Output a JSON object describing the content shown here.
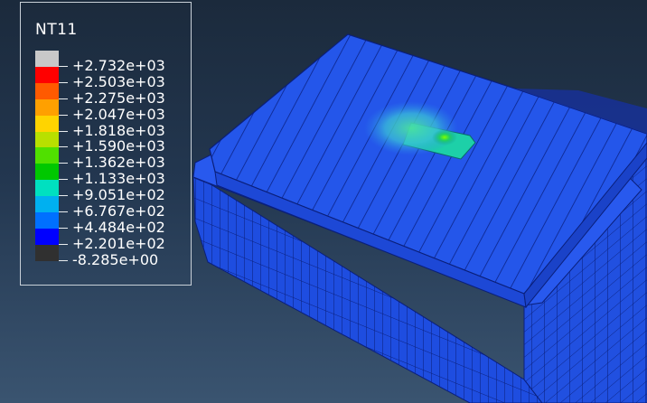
{
  "legend": {
    "title": "NT11",
    "colors": [
      "#c8c8c8",
      "#ff0000",
      "#ff5a00",
      "#ffa000",
      "#ffd400",
      "#b8e000",
      "#50e000",
      "#00c800",
      "#00e0c0",
      "#00b0f0",
      "#0070ff",
      "#0000ff",
      "#303030"
    ],
    "labels": [
      "+2.732e+03",
      "+2.503e+03",
      "+2.275e+03",
      "+2.047e+03",
      "+1.818e+03",
      "+1.590e+03",
      "+1.362e+03",
      "+1.133e+03",
      "+9.051e+02",
      "+6.767e+02",
      "+4.484e+02",
      "+2.201e+02",
      "-8.285e+00"
    ]
  },
  "model": {
    "mesh_color": "#1f4fe6",
    "edge_color": "#0a1f7a",
    "hotspot_color": "#5ce000"
  }
}
